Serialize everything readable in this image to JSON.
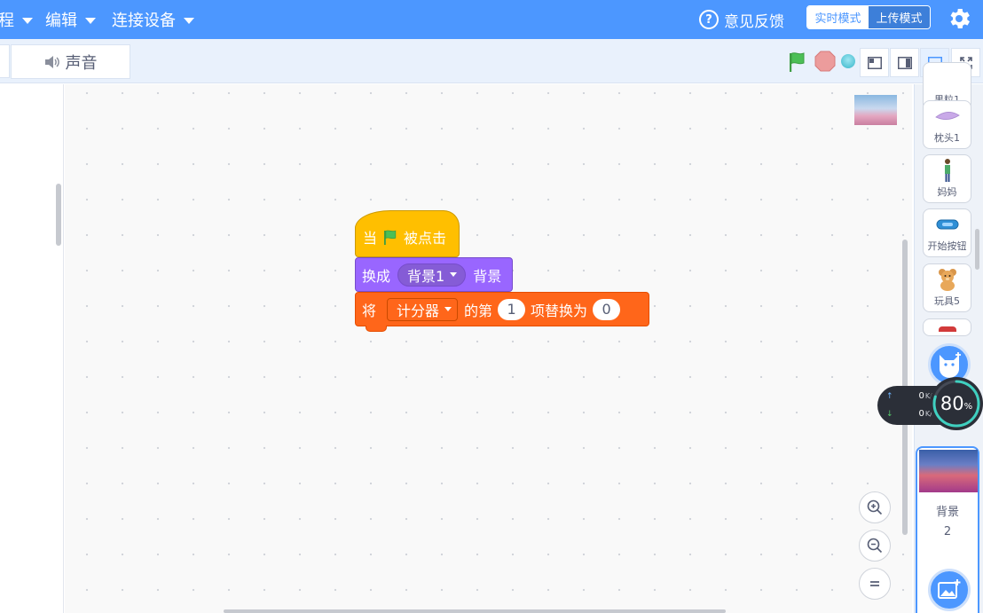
{
  "menu": {
    "items": [
      {
        "label": "程"
      },
      {
        "label": "编辑"
      },
      {
        "label": "连接设备"
      }
    ],
    "feedback_label": "意见反馈",
    "mode_toggle": {
      "realtime": "实时模式",
      "upload": "上传模式",
      "selected": "realtime"
    }
  },
  "tabs": {
    "sound_label": "声音"
  },
  "blocks": {
    "hat": {
      "when": "当",
      "clicked": "被点击"
    },
    "looks": {
      "switch_to": "换成",
      "backdrop_value": "背景1",
      "backdrop": "背景"
    },
    "data": {
      "set": "将",
      "list_value": "计分器",
      "item_of": "的第",
      "index": "1",
      "replace_with": "项替换为",
      "value": "0"
    }
  },
  "sprites": [
    {
      "name": "果粒1",
      "icon": "fruit-icon"
    },
    {
      "name": "枕头1",
      "icon": "pillow-icon"
    },
    {
      "name": "妈妈",
      "icon": "mom-icon"
    },
    {
      "name": "开始按钮",
      "icon": "start-button-icon"
    },
    {
      "name": "玩具5",
      "icon": "teddy-bear-icon"
    }
  ],
  "stage": {
    "label": "背景",
    "backdrop_count": "2"
  },
  "network": {
    "upload_value": "0",
    "upload_unit": "K/s",
    "download_value": "0",
    "download_unit": "K/s",
    "gauge_value": "80",
    "gauge_unit": "%"
  },
  "colors": {
    "menubar": "#4c97ff",
    "events": "#ffbf00",
    "looks": "#9966ff",
    "variables": "#ff661a",
    "flag": "#4cbf56",
    "stop": "#ec9c9c"
  }
}
